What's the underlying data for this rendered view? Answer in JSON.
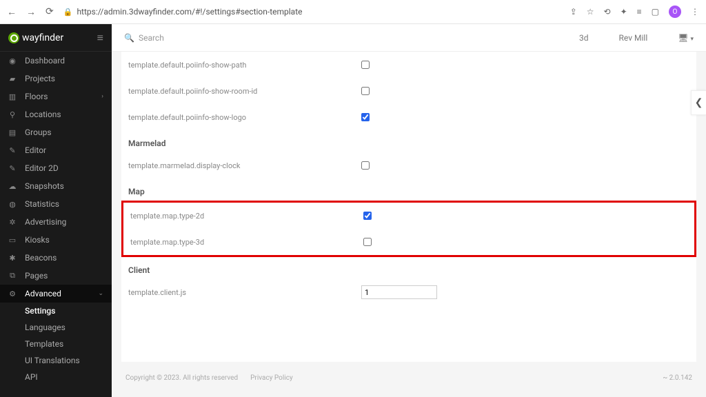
{
  "browser": {
    "url": "https://admin.3dwayfinder.com/#!/settings#section-template",
    "avatar_initial": "O"
  },
  "logo": {
    "text": "wayfinder"
  },
  "sidebar": {
    "items": [
      {
        "icon": "◉",
        "label": "Dashboard"
      },
      {
        "icon": "▰",
        "label": "Projects"
      },
      {
        "icon": "▥",
        "label": "Floors",
        "chev": true
      },
      {
        "icon": "⚲",
        "label": "Locations"
      },
      {
        "icon": "▤",
        "label": "Groups"
      },
      {
        "icon": "✎",
        "label": "Editor"
      },
      {
        "icon": "✎",
        "label": "Editor 2D"
      },
      {
        "icon": "☁",
        "label": "Snapshots"
      },
      {
        "icon": "◍",
        "label": "Statistics"
      },
      {
        "icon": "✲",
        "label": "Advertising"
      },
      {
        "icon": "▭",
        "label": "Kiosks"
      },
      {
        "icon": "✱",
        "label": "Beacons"
      },
      {
        "icon": "⧉",
        "label": "Pages"
      },
      {
        "icon": "⚙",
        "label": "Advanced",
        "chev_down": true,
        "active": true
      }
    ],
    "subitems": [
      {
        "label": "Settings",
        "active": true
      },
      {
        "label": "Languages"
      },
      {
        "label": "Templates"
      },
      {
        "label": "UI Translations"
      },
      {
        "label": "API"
      }
    ]
  },
  "topbar": {
    "search_placeholder": "Search",
    "project": "3d",
    "user": "Rev Mill"
  },
  "settings": {
    "rows": [
      {
        "label": "template.default.poiinfo-show-path",
        "checked": false
      },
      {
        "label": "template.default.poiinfo-show-room-id",
        "checked": false
      },
      {
        "label": "template.default.poiinfo-show-logo",
        "checked": true
      }
    ],
    "marmelad_title": "Marmelad",
    "marmelad_rows": [
      {
        "label": "template.marmelad.display-clock",
        "checked": false
      }
    ],
    "map_title": "Map",
    "map_rows": [
      {
        "label": "template.map.type-2d",
        "checked": true
      },
      {
        "label": "template.map.type-3d",
        "checked": false
      }
    ],
    "client_title": "Client",
    "client_rows": [
      {
        "label": "template.client.js",
        "value": "1"
      }
    ]
  },
  "footer": {
    "copyright": "Copyright © 2023. All rights reserved",
    "privacy": "Privacy Policy",
    "version": "~ 2.0.142"
  }
}
